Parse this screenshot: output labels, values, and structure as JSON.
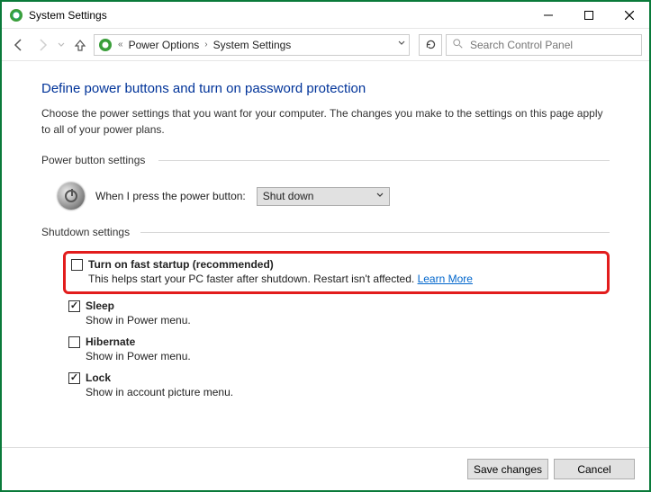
{
  "window": {
    "title": "System Settings"
  },
  "breadcrumb": {
    "overflow": "«",
    "part1": "Power Options",
    "part2": "System Settings"
  },
  "search": {
    "placeholder": "Search Control Panel"
  },
  "main": {
    "heading": "Define power buttons and turn on password protection",
    "description": "Choose the power settings that you want for your computer. The changes you make to the settings on this page apply to all of your power plans.",
    "section_power": "Power button settings",
    "power_label": "When I press the power button:",
    "power_action": "Shut down",
    "section_shutdown": "Shutdown settings",
    "shutdown_items": [
      {
        "checked": false,
        "title": "Turn on fast startup (recommended)",
        "desc": "This helps start your PC faster after shutdown. Restart isn't affected. ",
        "link": "Learn More"
      },
      {
        "checked": true,
        "title": "Sleep",
        "desc": "Show in Power menu."
      },
      {
        "checked": false,
        "title": "Hibernate",
        "desc": "Show in Power menu."
      },
      {
        "checked": true,
        "title": "Lock",
        "desc": "Show in account picture menu."
      }
    ]
  },
  "footer": {
    "save": "Save changes",
    "cancel": "Cancel"
  }
}
